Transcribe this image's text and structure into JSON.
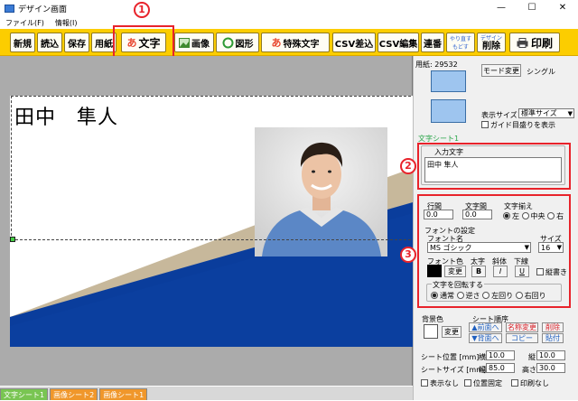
{
  "window": {
    "title": "デザイン画面",
    "minimize": "—",
    "maximize": "☐",
    "close": "✕"
  },
  "menu": [
    "ファイル(F)",
    "情報(I)"
  ],
  "toolbar": {
    "new": "新規",
    "load": "読込",
    "save": "保存",
    "paper": "用紙",
    "text_glyph": "あ",
    "text": "文字",
    "image": "画像",
    "shape": "図形",
    "special_glyph": "あ",
    "special": "特殊文字",
    "csv_insert": "CSV差込",
    "csv_edit": "CSV編集",
    "serial": "連番",
    "redo": "やり直す",
    "undo": "もどす",
    "design_small": "デザイン",
    "delete": "削除",
    "print": "印刷"
  },
  "badges": {
    "b1": "1",
    "b2": "2",
    "b3": "3"
  },
  "canvas": {
    "name_text": "田中　隼人"
  },
  "panel": {
    "paper_label": "用紙: 29532",
    "mode_change": "モード変更",
    "mode_value": "シングル",
    "display_size_label": "表示サイズ",
    "display_size_value": "標準サイズ",
    "guide_label": "ガイド目盛りを表示",
    "sheet_label": "文字シート1",
    "textbox_caption": "入力文字",
    "textbox_value": "田中 隼人",
    "row_spacing_label": "行間",
    "row_spacing_value": "0.0",
    "char_spacing_label": "文字間",
    "char_spacing_value": "0.0",
    "align_label": "文字揃え",
    "align_options": [
      "左",
      "中央",
      "右"
    ],
    "font_settings_label": "フォントの設定",
    "font_name_label": "フォント名",
    "font_name_value": "MS ゴシック",
    "size_label": "サイズ",
    "size_value": "16",
    "font_color_label": "フォント色",
    "bold_label": "太字",
    "italic_label": "斜体",
    "underline_label": "下線",
    "change_btn": "変更",
    "bold_btn": "B",
    "italic_btn": "I",
    "underline_btn": "U",
    "vertical_label": "縦書き",
    "rotate_label": "文字を回転する",
    "rotate_options": [
      "通常",
      "逆さ",
      "左回り",
      "右回り"
    ],
    "bg_color_label": "背景色",
    "sheet_order_label": "シート順序",
    "front_btn": "▲前面へ",
    "back_btn": "▼背面へ",
    "name_change_btn": "名称変更",
    "copy_btn": "コピー",
    "delete_btn": "削除",
    "paste_btn": "貼付",
    "sheet_pos_label": "シート位置 [mm]",
    "horizontal_label": "横",
    "horizontal_value": "10.0",
    "vertical_pos_label": "縦",
    "vertical_pos_value": "10.0",
    "sheet_size_label": "シートサイズ [mm]",
    "width_label": "幅",
    "width_value": "85.0",
    "height_label": "高さ",
    "height_value": "30.0",
    "hide_label": "表示なし",
    "fix_label": "位置固定",
    "no_print_label": "印刷なし"
  },
  "sheet_tabs": [
    {
      "label": "文字シート1",
      "color": "#79c552"
    },
    {
      "label": "画像シート2",
      "color": "#f0972b"
    },
    {
      "label": "画像シート1",
      "color": "#f0972b"
    }
  ],
  "colors": {
    "toolbar": "#fccd00",
    "accent_red": "#e8232b",
    "card_blue": "#0a3d9c",
    "font_color": "#000000",
    "bg_color": "#ffffff"
  }
}
